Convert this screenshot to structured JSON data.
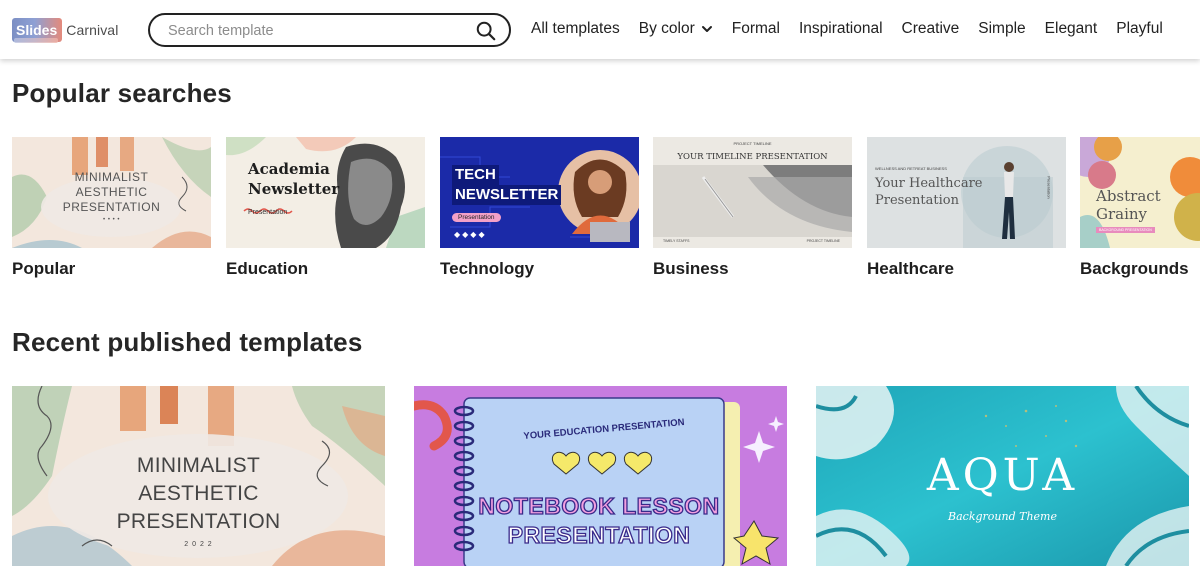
{
  "header": {
    "logo": {
      "part1": "Slides",
      "part2": "Carnival"
    },
    "search": {
      "placeholder": "Search template",
      "icon": "search-icon"
    },
    "nav": [
      {
        "label": "All templates"
      },
      {
        "label": "By color",
        "icon": "chevron-down-icon"
      },
      {
        "label": "Formal"
      },
      {
        "label": "Inspirational"
      },
      {
        "label": "Creative"
      },
      {
        "label": "Simple"
      },
      {
        "label": "Elegant"
      },
      {
        "label": "Playful"
      }
    ]
  },
  "popular": {
    "title": "Popular searches",
    "cards": [
      {
        "label": "Popular",
        "thumb": {
          "line1": "MINIMALIST",
          "line2": "AESTHETIC",
          "line3": "PRESENTATION",
          "dots": "• • • •"
        }
      },
      {
        "label": "Education",
        "thumb": {
          "line1": "Academia",
          "line2": "Newsletter",
          "sub": "Presentation"
        }
      },
      {
        "label": "Technology",
        "thumb": {
          "line1": "TECH",
          "line2": "NEWSLETTER",
          "sub": "Presentation",
          "dots": "◆◆◆◆"
        }
      },
      {
        "label": "Business",
        "thumb": {
          "top": "PROJECT TIMELINE",
          "line1": "YOUR TIMELINE PRESENTATION",
          "foot_left": "TIMELY STAFFS",
          "foot_right": "PROJECT TIMELINE"
        }
      },
      {
        "label": "Healthcare",
        "thumb": {
          "top": "WELLNESS AND RETREAT BUSINESS",
          "line1": "Your Healthcare",
          "line2": "Presentation",
          "side": "Presentation"
        }
      },
      {
        "label": "Backgrounds",
        "thumb": {
          "line1": "Abstract",
          "line2": "Grainy",
          "sub": "BACKGROUND PRESENTATION"
        }
      }
    ]
  },
  "recent": {
    "title": "Recent published templates",
    "cards": [
      {
        "line1": "MINIMALIST",
        "line2": "AESTHETIC",
        "line3": "PRESENTATION",
        "year": "2 0 2 2"
      },
      {
        "top": "YOUR EDUCATION PRESENTATION",
        "line1": "NOTEBOOK LESSON",
        "line2": "PRESENTATION"
      },
      {
        "line1": "AQUA",
        "line2": "Background Theme"
      }
    ]
  },
  "colors": {
    "accent_red": "#e2574c",
    "tech_blue": "#1b2aa8",
    "notebook_purple": "#c87be0",
    "aqua": "#2bb3c3"
  }
}
